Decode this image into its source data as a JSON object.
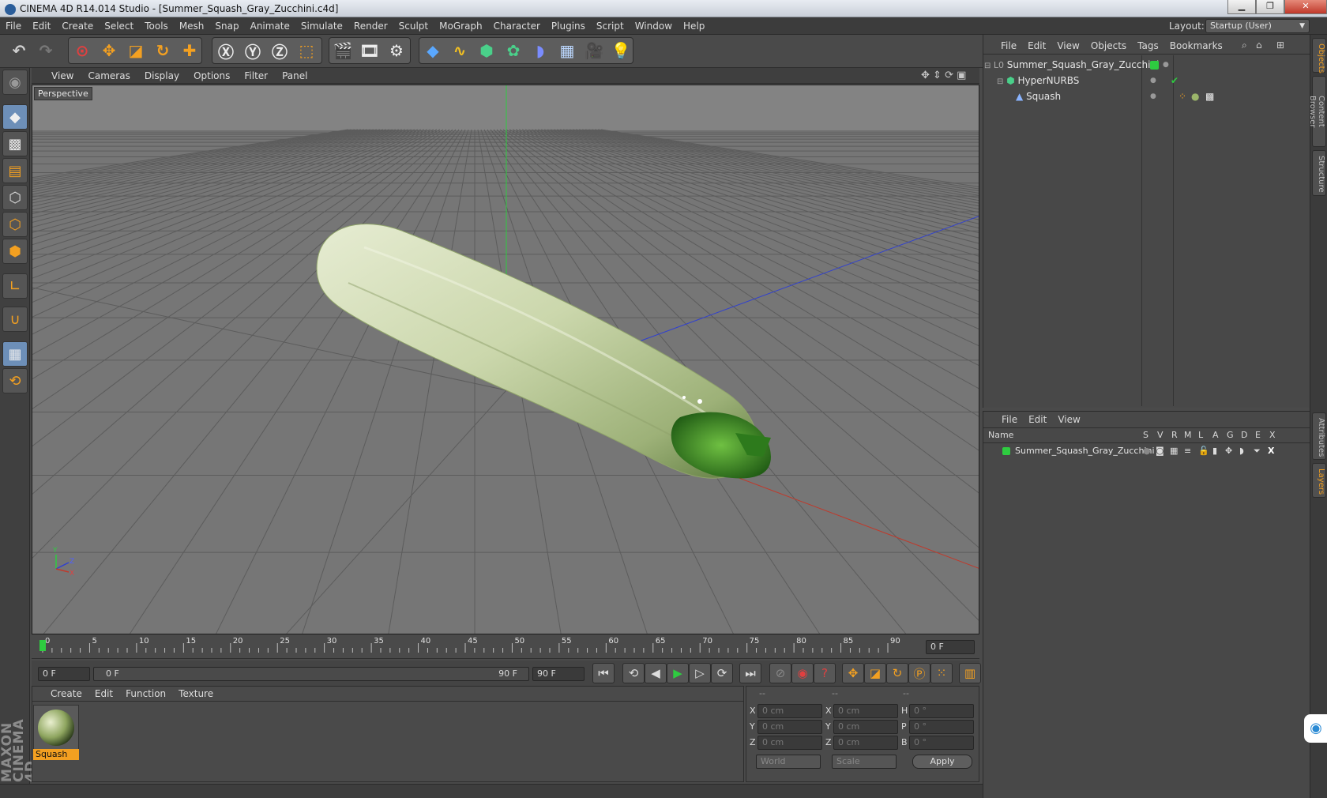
{
  "title": "CINEMA 4D R14.014 Studio - [Summer_Squash_Gray_Zucchini.c4d]",
  "window_buttons": {
    "minimize": "▁",
    "maximize": "❐",
    "close": "✕"
  },
  "menu": [
    "File",
    "Edit",
    "Create",
    "Select",
    "Tools",
    "Mesh",
    "Snap",
    "Animate",
    "Simulate",
    "Render",
    "Sculpt",
    "MoGraph",
    "Character",
    "Plugins",
    "Script",
    "Window",
    "Help"
  ],
  "layout": {
    "label": "Layout:",
    "value": "Startup (User)"
  },
  "viewport": {
    "menu": [
      "View",
      "Cameras",
      "Display",
      "Options",
      "Filter",
      "Panel"
    ],
    "label": "Perspective",
    "axis_labels": {
      "y": "Y",
      "z": "Z",
      "x": "X"
    }
  },
  "timeline": {
    "ticks": [
      "0",
      "5",
      "10",
      "15",
      "20",
      "25",
      "30",
      "35",
      "40",
      "45",
      "50",
      "55",
      "60",
      "65",
      "70",
      "75",
      "80",
      "85",
      "90"
    ],
    "frame_display": "0 F"
  },
  "controls": {
    "start_field": "0 F",
    "range_start": "0 F",
    "range_end": "90 F",
    "end_field": "90 F"
  },
  "materials": {
    "menu": [
      "Create",
      "Edit",
      "Function",
      "Texture"
    ],
    "items": [
      {
        "name": "Squash"
      }
    ]
  },
  "coords": {
    "headers": [
      "--",
      "--",
      "--"
    ],
    "rows": [
      {
        "a": "X",
        "av": "0 cm",
        "b": "X",
        "bv": "0 cm",
        "c": "H",
        "cv": "0 °"
      },
      {
        "a": "Y",
        "av": "0 cm",
        "b": "Y",
        "bv": "0 cm",
        "c": "P",
        "cv": "0 °"
      },
      {
        "a": "Z",
        "av": "0 cm",
        "b": "Z",
        "bv": "0 cm",
        "c": "B",
        "cv": "0 °"
      }
    ],
    "world": "World",
    "scale": "Scale",
    "apply": "Apply"
  },
  "objects": {
    "menu": [
      "File",
      "Edit",
      "View",
      "Objects",
      "Tags",
      "Bookmarks"
    ],
    "tree": [
      {
        "name": "Summer_Squash_Gray_Zucchini",
        "level": 0
      },
      {
        "name": "HyperNURBS",
        "level": 1
      },
      {
        "name": "Squash",
        "level": 2
      }
    ]
  },
  "layers": {
    "menu": [
      "File",
      "Edit",
      "View"
    ],
    "columns": [
      "Name",
      "S",
      "V",
      "R",
      "M",
      "L",
      "A",
      "G",
      "D",
      "E",
      "X"
    ],
    "rows": [
      {
        "name": "Summer_Squash_Gray_Zucchini"
      }
    ]
  },
  "side_tabs": [
    "Objects",
    "Content Browser",
    "Structure",
    "Attributes",
    "Layers"
  ],
  "brand": "MAXON CINEMA 4D",
  "colors": {
    "accent": "#f3a021",
    "layer_green": "#2ecc40",
    "axis_red": "#c0392b",
    "axis_blue": "#3040d0",
    "axis_green": "#2ecc40"
  }
}
